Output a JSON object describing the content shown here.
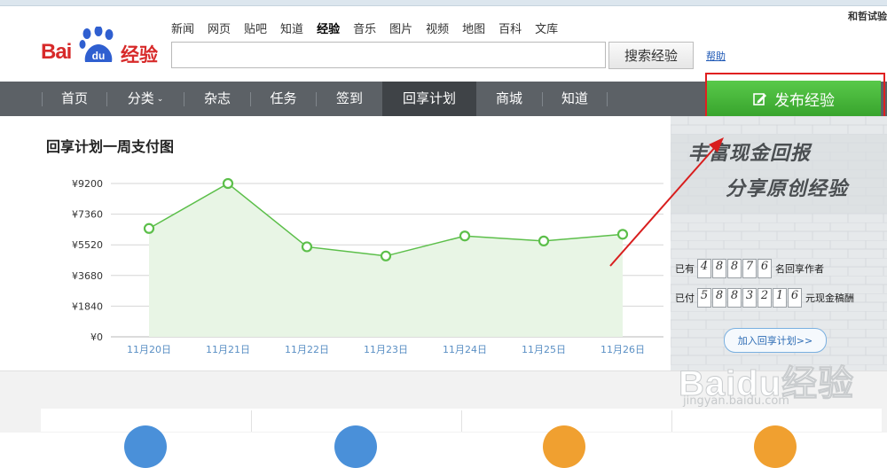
{
  "header": {
    "logo": {
      "bai": "Bai",
      "du": "du",
      "jingyan": "经验"
    },
    "nav_links": [
      "新闻",
      "网页",
      "贴吧",
      "知道",
      "经验",
      "音乐",
      "图片",
      "视频",
      "地图",
      "百科",
      "文库"
    ],
    "active_nav_link": "经验",
    "user_name": "和哲试验",
    "search": {
      "value": "",
      "placeholder": ""
    },
    "search_button": "搜索经验",
    "help_link": "帮助"
  },
  "main_nav": {
    "items": [
      "首页",
      "分类",
      "杂志",
      "任务",
      "签到",
      "回享计划",
      "商城",
      "知道"
    ],
    "active": "回享计划",
    "dropdown_item": "分类",
    "publish_button": "发布经验"
  },
  "chart_title": "回享计划一周支付图",
  "chart_data": {
    "type": "area",
    "title": "回享计划一周支付图",
    "categories": [
      "11月20日",
      "11月21日",
      "11月22日",
      "11月23日",
      "11月24日",
      "11月25日",
      "11月26日"
    ],
    "values": [
      6500,
      9200,
      5400,
      4850,
      6050,
      5750,
      6150
    ],
    "y_ticks": [
      "¥0",
      "¥1840",
      "¥3680",
      "¥5520",
      "¥7360",
      "¥9200"
    ],
    "ylim": [
      0,
      9200
    ],
    "grid": true,
    "line_color": "#5cbf4a",
    "fill_color": "#e8f5e5"
  },
  "promo": {
    "slogan_line1": "丰富现金回报",
    "slogan_line2": "分享原创经验",
    "authors": {
      "prefix": "已有",
      "digits": [
        "4",
        "8",
        "8",
        "7",
        "6"
      ],
      "suffix": "名回享作者"
    },
    "paid": {
      "prefix": "已付",
      "digits": [
        "5",
        "8",
        "8",
        "3",
        "2",
        "1",
        "6"
      ],
      "suffix": "元现金稿酬"
    },
    "join_button": "加入回享计划>>",
    "watermark_logo": "Baidu经验",
    "watermark_url": "jingyan.baidu.com"
  },
  "colors": {
    "nav_bg": "#5c6166",
    "nav_active": "#3f4347",
    "publish_green": "#3fae33",
    "annotation_red": "#e02020",
    "logo_red": "#d72a2a",
    "logo_blue": "#2f5fd0"
  }
}
